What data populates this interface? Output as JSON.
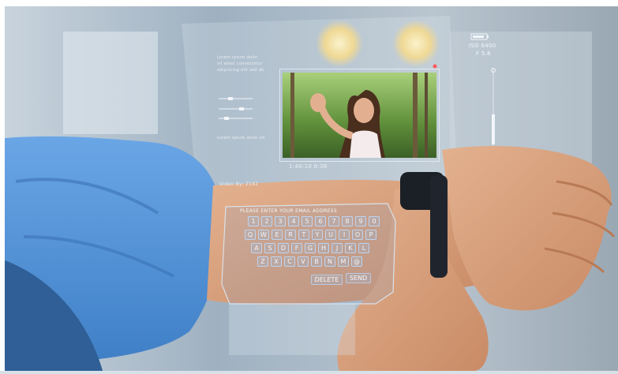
{
  "hud": {
    "iso": "ISO 6400",
    "fstop": "F 5.6",
    "timestamp": "1:40:10 8:38",
    "video_label": "Video By: 2142",
    "prompt": "PLEASE ENTER YOUR EMAIL ADDRESS",
    "left_panel_text": [
      "Lorem ipsum dolor",
      "sit amet consectetur",
      "adipiscing elit sed do"
    ],
    "eiusmod": "Lorem ipsum dolor sit"
  },
  "keyboard": {
    "rows": [
      [
        "1",
        "2",
        "3",
        "4",
        "5",
        "6",
        "7",
        "8",
        "9",
        "0"
      ],
      [
        "Q",
        "W",
        "E",
        "R",
        "T",
        "Y",
        "U",
        "I",
        "O",
        "P"
      ],
      [
        "A",
        "S",
        "D",
        "F",
        "G",
        "H",
        "J",
        "K",
        "L"
      ],
      [
        "Z",
        "X",
        "C",
        "V",
        "B",
        "N",
        "M",
        "@"
      ]
    ],
    "delete_label": "DELETE",
    "send_label": "SEND"
  },
  "colors": {
    "hud": "#f2f6fa",
    "shirt": "#4b8fd6",
    "skin": "#d9a07c",
    "watch": "#1b1f26"
  }
}
